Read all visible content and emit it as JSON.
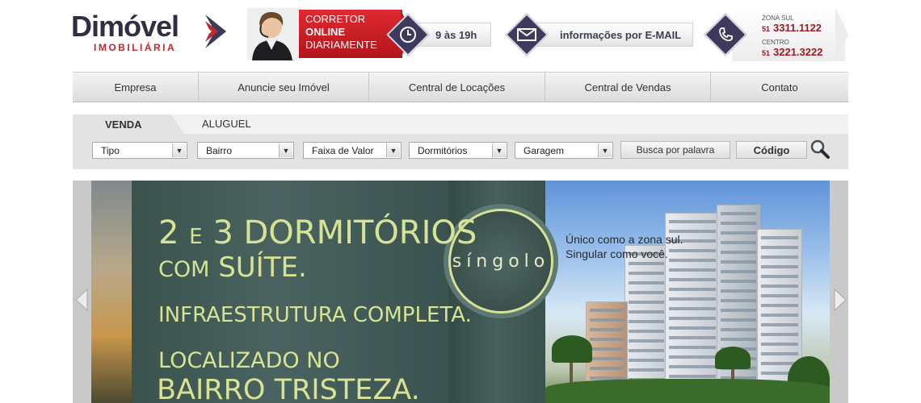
{
  "logo": {
    "name": "Dimóvel",
    "subtitle": "IMOBILIÁRIA"
  },
  "header": {
    "online_line1": "CORRETOR",
    "online_line2": "ONLINE",
    "online_line3": "DIARIAMENTE",
    "hours": "9 às 19h",
    "email_label": "informações por E-MAIL",
    "zona_sul_label": "ZONA SUL",
    "zona_sul_prefix": "51",
    "zona_sul_phone": "3311.1122",
    "centro_label": "CENTRO",
    "centro_prefix": "51",
    "centro_phone": "3221.3222"
  },
  "nav": {
    "items": [
      {
        "label": "Empresa"
      },
      {
        "label": "Anuncie seu Imóvel"
      },
      {
        "label": "Central de Locações"
      },
      {
        "label": "Central de Vendas"
      },
      {
        "label": "Contato"
      }
    ]
  },
  "search": {
    "tab_venda": "VENDA",
    "tab_aluguel": "ALUGUEL",
    "filters": [
      "Tipo",
      "Bairro",
      "Faixa de Valor",
      "Dormitórios",
      "Garagem"
    ],
    "keyword_button": "Busca por palavra",
    "code_button": "Código"
  },
  "banner": {
    "line1_a": "2",
    "line1_b": "E",
    "line1_c": "3 DORMITÓRIOS",
    "line2_a": "COM",
    "line2_b": "SUÍTE.",
    "line3": "INFRAESTRUTURA COMPLETA.",
    "line4": "LOCALIZADO NO",
    "line5": "BAIRRO TRISTEZA.",
    "brand": "síngolo",
    "slogan_1": "Único como a zona sul.",
    "slogan_2": "Singular como você."
  },
  "colors": {
    "brand_red": "#c0282d",
    "brand_navy": "#2f2f44",
    "banner_text": "#d6e394"
  },
  "icons": [
    "clock-icon",
    "envelope-icon",
    "phone-icon",
    "search-icon",
    "chevron-left-icon",
    "chevron-right-icon"
  ]
}
